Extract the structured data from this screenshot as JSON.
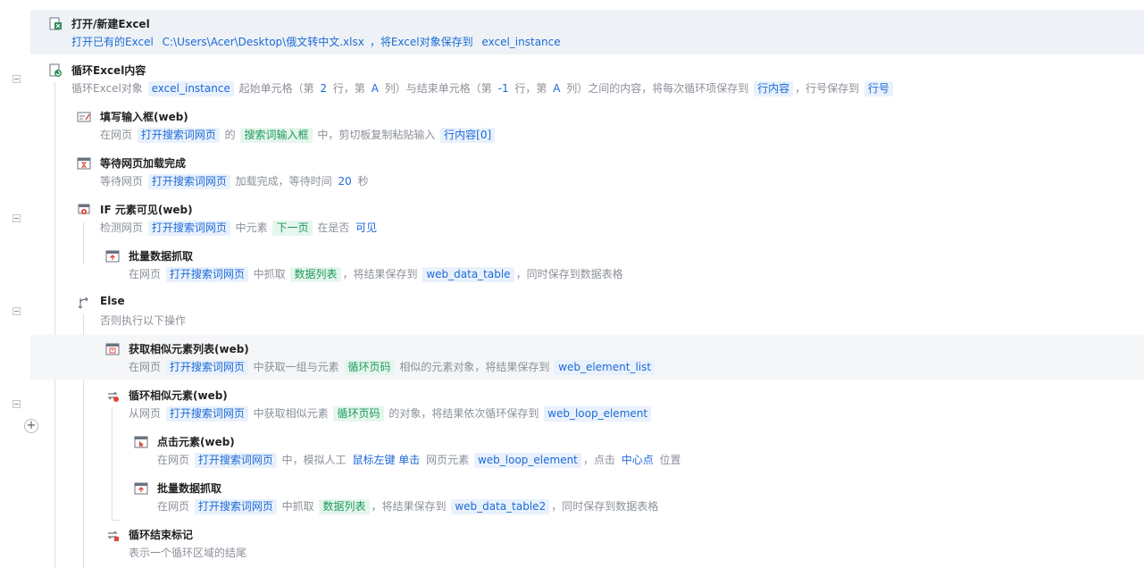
{
  "steps": [
    {
      "title": "打开/新建Excel",
      "icon": "excel-open-icon",
      "parts": [
        {
          "t": "text",
          "v": "打开已有的Excel "
        },
        {
          "t": "blue",
          "v": "C:\\Users\\Acer\\Desktop\\俄文转中文.xlsx"
        },
        {
          "t": "text",
          "v": "，将Excel对象保存到 "
        },
        {
          "t": "blue",
          "v": "excel_instance"
        }
      ]
    },
    {
      "title": "循环Excel内容",
      "icon": "excel-loop-icon",
      "parts": [
        {
          "t": "text",
          "v": "循环Excel对象 "
        },
        {
          "t": "blue",
          "v": "excel_instance"
        },
        {
          "t": "text",
          "v": " 起始单元格（第 "
        },
        {
          "t": "plain",
          "v": "2"
        },
        {
          "t": "text",
          "v": " 行，第 "
        },
        {
          "t": "plain",
          "v": "A"
        },
        {
          "t": "text",
          "v": " 列）与结束单元格（第 "
        },
        {
          "t": "plain",
          "v": "-1"
        },
        {
          "t": "text",
          "v": " 行，第 "
        },
        {
          "t": "plain",
          "v": "A"
        },
        {
          "t": "text",
          "v": " 列）之间的内容，将每次循环项保存到 "
        },
        {
          "t": "blue",
          "v": "行内容"
        },
        {
          "t": "text",
          "v": "，行号保存到 "
        },
        {
          "t": "blue",
          "v": "行号"
        }
      ]
    },
    {
      "title": "填写输入框(web)",
      "icon": "input-fill-icon",
      "parts": [
        {
          "t": "text",
          "v": "在网页 "
        },
        {
          "t": "blue",
          "v": "打开搜索词网页"
        },
        {
          "t": "text",
          "v": " 的 "
        },
        {
          "t": "green",
          "v": "搜索词输入框"
        },
        {
          "t": "text",
          "v": " 中，剪切板复制粘贴输入 "
        },
        {
          "t": "blue",
          "v": "行内容[0]"
        }
      ]
    },
    {
      "title": "等待网页加载完成",
      "icon": "page-wait-icon",
      "parts": [
        {
          "t": "text",
          "v": "等待网页 "
        },
        {
          "t": "blue",
          "v": "打开搜索词网页"
        },
        {
          "t": "text",
          "v": " 加载完成，等待时间 "
        },
        {
          "t": "plain",
          "v": "20"
        },
        {
          "t": "text",
          "v": " 秒"
        }
      ]
    },
    {
      "title": "IF 元素可见(web)",
      "icon": "if-element-visible-icon",
      "parts": [
        {
          "t": "text",
          "v": "检测网页 "
        },
        {
          "t": "blue",
          "v": "打开搜索词网页"
        },
        {
          "t": "text",
          "v": " 中元素 "
        },
        {
          "t": "green",
          "v": "下一页"
        },
        {
          "t": "text",
          "v": " 在是否 "
        },
        {
          "t": "plain",
          "v": "可见"
        }
      ]
    },
    {
      "title": "批量数据抓取",
      "icon": "data-scrape-icon",
      "parts": [
        {
          "t": "text",
          "v": "在网页 "
        },
        {
          "t": "blue",
          "v": "打开搜索词网页"
        },
        {
          "t": "text",
          "v": " 中抓取 "
        },
        {
          "t": "green",
          "v": "数据列表"
        },
        {
          "t": "text",
          "v": "，将结果保存到 "
        },
        {
          "t": "blue",
          "v": "web_data_table"
        },
        {
          "t": "text",
          "v": "，同时保存到数据表格"
        }
      ]
    },
    {
      "title": "Else",
      "icon": "else-branch-icon",
      "parts": [
        {
          "t": "text",
          "v": "否则执行以下操作"
        }
      ]
    },
    {
      "title": "获取相似元素列表(web)",
      "icon": "similar-elements-icon",
      "parts": [
        {
          "t": "text",
          "v": "在网页 "
        },
        {
          "t": "blue",
          "v": "打开搜索词网页"
        },
        {
          "t": "text",
          "v": " 中获取一组与元素 "
        },
        {
          "t": "green",
          "v": "循环页码"
        },
        {
          "t": "text",
          "v": " 相似的元素对象，将结果保存到 "
        },
        {
          "t": "blue",
          "v": "web_element_list"
        }
      ]
    },
    {
      "title": "循环相似元素(web)",
      "icon": "loop-similar-icon",
      "parts": [
        {
          "t": "text",
          "v": "从网页 "
        },
        {
          "t": "blue",
          "v": "打开搜索词网页"
        },
        {
          "t": "text",
          "v": " 中获取相似元素 "
        },
        {
          "t": "green",
          "v": "循环页码"
        },
        {
          "t": "text",
          "v": " 的对象，将结果依次循环保存到 "
        },
        {
          "t": "blue",
          "v": "web_loop_element"
        }
      ]
    },
    {
      "title": "点击元素(web)",
      "icon": "click-element-icon",
      "parts": [
        {
          "t": "text",
          "v": "在网页 "
        },
        {
          "t": "blue",
          "v": "打开搜索词网页"
        },
        {
          "t": "text",
          "v": " 中，模拟人工 "
        },
        {
          "t": "plain",
          "v": "鼠标左键 单击"
        },
        {
          "t": "text",
          "v": " 网页元素 "
        },
        {
          "t": "blue",
          "v": "web_loop_element"
        },
        {
          "t": "text",
          "v": "，点击 "
        },
        {
          "t": "plain",
          "v": "中心点"
        },
        {
          "t": "text",
          "v": " 位置"
        }
      ]
    },
    {
      "title": "批量数据抓取",
      "icon": "data-scrape-icon",
      "parts": [
        {
          "t": "text",
          "v": "在网页 "
        },
        {
          "t": "blue",
          "v": "打开搜索词网页"
        },
        {
          "t": "text",
          "v": " 中抓取 "
        },
        {
          "t": "green",
          "v": "数据列表"
        },
        {
          "t": "text",
          "v": "，将结果保存到 "
        },
        {
          "t": "blue",
          "v": "web_data_table2"
        },
        {
          "t": "text",
          "v": "，同时保存到数据表格"
        }
      ]
    },
    {
      "title": "循环结束标记",
      "icon": "loop-end-icon",
      "parts": [
        {
          "t": "text",
          "v": "表示一个循环区域的结尾"
        }
      ]
    }
  ],
  "add_button": "+"
}
